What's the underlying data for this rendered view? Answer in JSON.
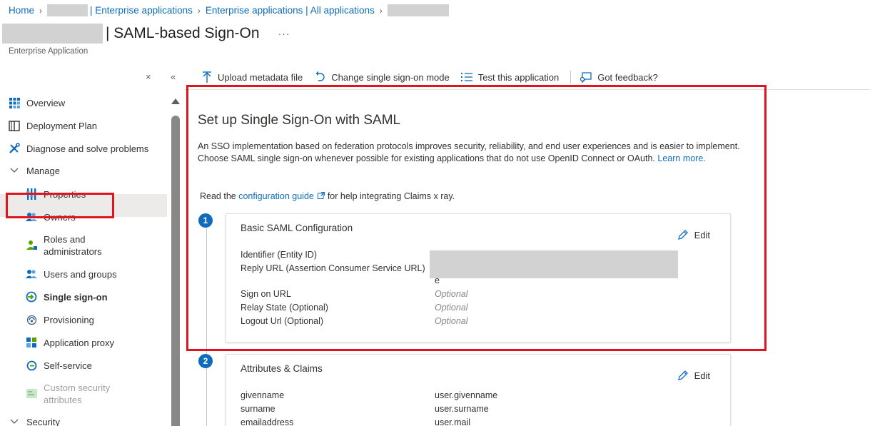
{
  "breadcrumb": {
    "home": "Home",
    "enterprise_apps": "Enterprise applications",
    "all_apps": "Enterprise applications | All applications"
  },
  "header": {
    "title": "| SAML-based Sign-On",
    "more": "···",
    "subtitle": "Enterprise Application",
    "close": "×",
    "collapse": "«"
  },
  "sidebar": {
    "items": [
      {
        "label": "Overview",
        "icon": "overview-grid-icon"
      },
      {
        "label": "Deployment Plan",
        "icon": "book-icon"
      },
      {
        "label": "Diagnose and solve problems",
        "icon": "wrench-icon"
      },
      {
        "label": "Manage",
        "icon": "chevron-down-icon"
      },
      {
        "label": "Properties",
        "icon": "properties-icon"
      },
      {
        "label": "Owners",
        "icon": "owners-icon"
      },
      {
        "label": "Roles and administrators",
        "icon": "roles-icon"
      },
      {
        "label": "Users and groups",
        "icon": "users-icon"
      },
      {
        "label": "Single sign-on",
        "icon": "sso-icon"
      },
      {
        "label": "Provisioning",
        "icon": "provisioning-icon"
      },
      {
        "label": "Application proxy",
        "icon": "app-proxy-icon"
      },
      {
        "label": "Self-service",
        "icon": "self-service-icon"
      },
      {
        "label": "Custom security attributes",
        "icon": "custom-attributes-icon"
      },
      {
        "label": "Security",
        "icon": "chevron-down-icon"
      }
    ]
  },
  "toolbar": {
    "upload": "Upload metadata file",
    "change_mode": "Change single sign-on mode",
    "test": "Test this application",
    "feedback": "Got feedback?"
  },
  "main": {
    "heading": "Set up Single Sign-On with SAML",
    "intro": "An SSO implementation based on federation protocols improves security, reliability, and end user experiences and is easier to implement. Choose SAML single sign-on whenever possible for existing applications that do not use OpenID Connect or OAuth.",
    "learn_more": "Learn more.",
    "guide_prefix": "Read the",
    "guide_link": "configuration guide",
    "guide_suffix": "for help integrating Claims x ray."
  },
  "cards": {
    "basic": {
      "step": "1",
      "title": "Basic SAML Configuration",
      "edit": "Edit",
      "identifier": "Identifier (Entity ID)",
      "reply_url": "Reply URL (Assertion Consumer Service URL)",
      "reply_tail": "e",
      "sign_on_url": "Sign on URL",
      "sign_on_value": "Optional",
      "relay_state": "Relay State (Optional)",
      "relay_value": "Optional",
      "logout_url": "Logout Url (Optional)",
      "logout_value": "Optional"
    },
    "claims": {
      "step": "2",
      "title": "Attributes & Claims",
      "edit": "Edit",
      "rows": [
        {
          "k": "givenname",
          "v": "user.givenname"
        },
        {
          "k": "surname",
          "v": "user.surname"
        },
        {
          "k": "emailaddress",
          "v": "user.mail"
        }
      ]
    }
  },
  "colors": {
    "accent": "#0f6cbd",
    "highlight": "#e0141e"
  }
}
